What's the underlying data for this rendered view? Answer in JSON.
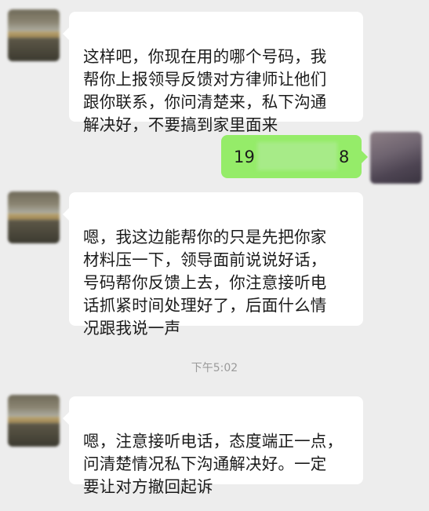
{
  "messages": [
    {
      "side": "left",
      "text": "这样吧，你现在用的哪个号码，我\n帮你上报领导反馈对方律师让他们\n跟你联系，你问清楚来，私下沟通\n解决好，不要搞到家里面来"
    },
    {
      "side": "right",
      "prefix": "19",
      "suffix": "8"
    },
    {
      "side": "left",
      "text": "嗯，我这边能帮你的只是先把你家\n材料压一下，领导面前说说好话，\n号码帮你反馈上去，你注意接听电\n话抓紧时间处理好了，后面什么情\n况跟我说一声"
    },
    {
      "side": "left",
      "text": "嗯，注意接听电话，态度端正一点，\n问清楚情况私下沟通解决好。一定\n要让对方撤回起诉"
    }
  ],
  "timestamp": "下午5:02",
  "colors": {
    "background": "#ededed",
    "incoming_bubble": "#ffffff",
    "outgoing_bubble": "#95ec69"
  }
}
